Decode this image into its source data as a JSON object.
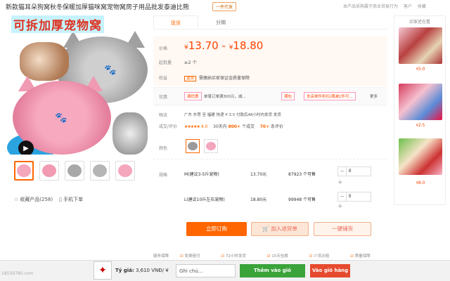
{
  "header": {
    "title": "新款猫耳朵狗窝秋冬保暖加厚猫咪窝宠物窝房子用品批发泰迪比熊",
    "badge": "一件代发",
    "top_links": [
      "本产品采购属于商业贸易行为",
      "客户",
      "收藏"
    ]
  },
  "gallery": {
    "banner_text": "可拆加厚宠物窝",
    "thumbnails": [
      "pink-bed",
      "pink-bed",
      "grey-bed",
      "grey-bed",
      "pink-bed"
    ],
    "collect_label": "收藏产品(258)",
    "mobile_label": "手机下单"
  },
  "tabs": [
    "现货",
    "分销"
  ],
  "price": {
    "label": "价格",
    "currency": "¥",
    "low": "13.70",
    "sep": "-",
    "high": "18.80",
    "min_order_label": "起批量",
    "min_order": "≥2 个"
  },
  "rights": {
    "label": "权益",
    "tag": "退货",
    "text": "需缴纳买家保证金质量保障"
  },
  "promo": {
    "label": "优惠",
    "tag1": "满优惠",
    "text1": "单笔订单满300元，减...",
    "tag2": "满包",
    "tag3": "本店单件折扣/满减1件可...",
    "more": "更多"
  },
  "shipping": {
    "label": "物流",
    "text": "广东 东莞    至 福建    快递 ¥ 3.5    付款后48小时内发货  发货"
  },
  "ratings": {
    "label": "成交/评价",
    "stars": "★★★★★",
    "score": "4.0",
    "days_label": "30天内",
    "sold": "800+",
    "sold_unit": "个成交",
    "reviews": "70+",
    "reviews_unit": "条评价"
  },
  "colors": {
    "label": "颜色",
    "swatches": [
      "grey",
      "pink"
    ]
  },
  "specs": {
    "label": "规格",
    "rows": [
      {
        "name": "M(建议3-5斤宠物)",
        "price": "13.70元",
        "stock": "87923 个可售",
        "qty": "0"
      },
      {
        "name": "L(建议10斤左右宠物)",
        "price": "18.80元",
        "stock": "99948 个可售",
        "qty": "0"
      }
    ]
  },
  "actions": {
    "buy": "立即订购",
    "cart": "加入进货单",
    "dist": "一键铺货"
  },
  "services": {
    "label": "服务保障",
    "items": [
      "免费赔付",
      "72小时发货",
      "15天包换",
      "少货必赔",
      "质量保障"
    ]
  },
  "sidebar": {
    "title": "买家还在看",
    "items": [
      {
        "price": "5.0"
      },
      {
        "price": "2.5"
      },
      {
        "price": "8.0"
      }
    ]
  },
  "bottom_bar": {
    "watermark": "18559780.com",
    "rate_label": "Tỷ giá:",
    "rate_value": "3,610 VNĐ/ ¥",
    "note_placeholder": "Ghi chú...",
    "add_button": "Thêm vào giỏ",
    "cart_button": "Vào giỏ hàng"
  },
  "colors_theme": {
    "accent": "#ff6600",
    "price": "#ff4400",
    "green": "#3aa33a",
    "red": "#e64a2e"
  }
}
